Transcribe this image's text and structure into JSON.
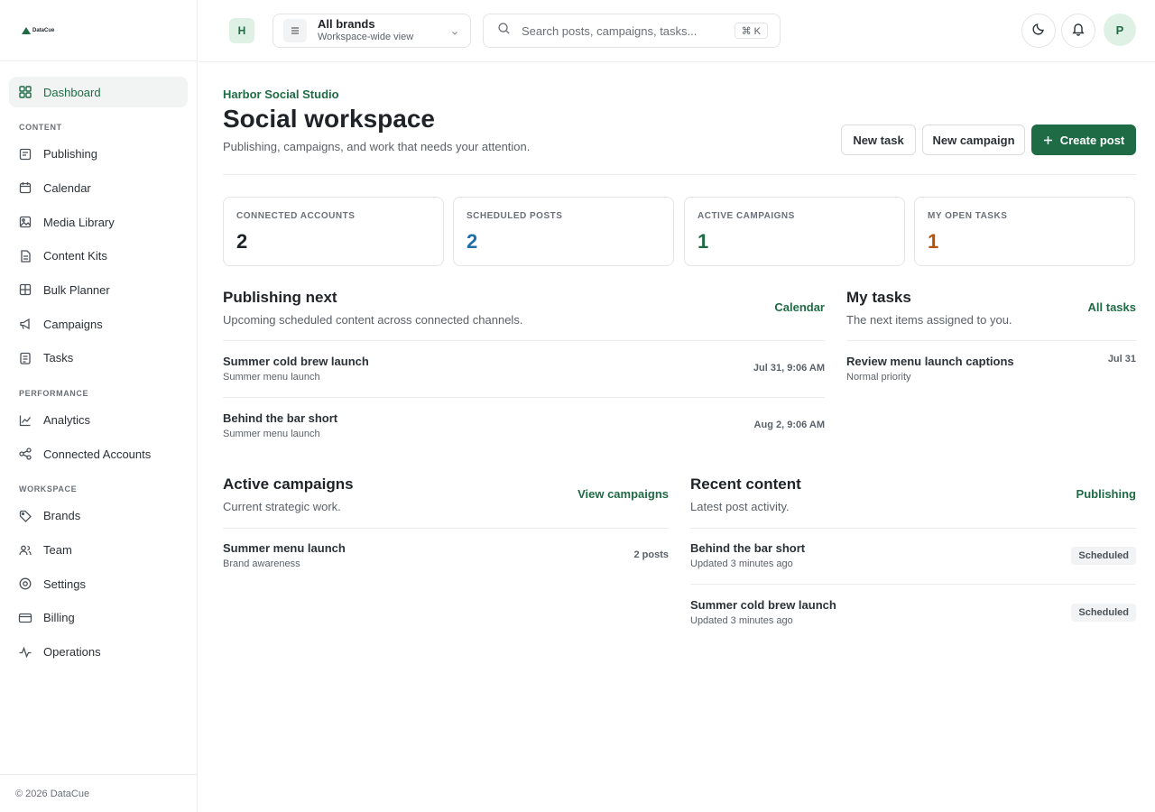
{
  "app": {
    "brand_name": "DataCue",
    "footer": "© 2026 DataCue"
  },
  "sidebar": {
    "top": [
      {
        "label": "Dashboard",
        "icon": "dashboard-icon",
        "active": true
      }
    ],
    "sections": [
      {
        "title": "CONTENT",
        "items": [
          {
            "label": "Publishing",
            "icon": "publishing-icon"
          },
          {
            "label": "Calendar",
            "icon": "calendar-icon"
          },
          {
            "label": "Media Library",
            "icon": "image-icon"
          },
          {
            "label": "Content Kits",
            "icon": "document-icon"
          },
          {
            "label": "Bulk Planner",
            "icon": "grid-icon"
          },
          {
            "label": "Campaigns",
            "icon": "megaphone-icon"
          },
          {
            "label": "Tasks",
            "icon": "checklist-icon"
          }
        ]
      },
      {
        "title": "PERFORMANCE",
        "items": [
          {
            "label": "Analytics",
            "icon": "chart-icon"
          },
          {
            "label": "Connected Accounts",
            "icon": "share-icon"
          }
        ]
      },
      {
        "title": "WORKSPACE",
        "items": [
          {
            "label": "Brands",
            "icon": "tag-icon"
          },
          {
            "label": "Team",
            "icon": "users-icon"
          },
          {
            "label": "Settings",
            "icon": "gear-icon"
          },
          {
            "label": "Billing",
            "icon": "card-icon"
          },
          {
            "label": "Operations",
            "icon": "pulse-icon"
          }
        ]
      }
    ]
  },
  "topbar": {
    "brand_initial": "H",
    "brand_selector": {
      "title": "All brands",
      "subtitle": "Workspace-wide view"
    },
    "search": {
      "placeholder": "Search posts, campaigns, tasks...",
      "shortcut": "⌘ K"
    },
    "avatar_initial": "P"
  },
  "header": {
    "eyebrow": "Harbor Social Studio",
    "title": "Social workspace",
    "subtitle": "Publishing, campaigns, and work that needs your attention.",
    "buttons": {
      "new_task": "New task",
      "new_campaign": "New campaign",
      "create_post": "Create post"
    }
  },
  "stats": [
    {
      "label": "CONNECTED ACCOUNTS",
      "value": "2",
      "color": "#1f2328"
    },
    {
      "label": "SCHEDULED POSTS",
      "value": "2",
      "color": "#1f6fa8"
    },
    {
      "label": "ACTIVE CAMPAIGNS",
      "value": "1",
      "color": "#1f6b45"
    },
    {
      "label": "MY OPEN TASKS",
      "value": "1",
      "color": "#b4530f"
    }
  ],
  "publishing_next": {
    "title": "Publishing next",
    "subtitle": "Upcoming scheduled content across connected channels.",
    "link": "Calendar",
    "rows": [
      {
        "title": "Summer cold brew launch",
        "sub": "Summer menu launch",
        "meta": "Jul 31, 9:06 AM"
      },
      {
        "title": "Behind the bar short",
        "sub": "Summer menu launch",
        "meta": "Aug 2, 9:06 AM"
      }
    ]
  },
  "my_tasks": {
    "title": "My tasks",
    "subtitle": "The next items assigned to you.",
    "link": "All tasks",
    "rows": [
      {
        "title": "Review menu launch captions",
        "sub": "Normal priority",
        "meta": "Jul 31"
      }
    ]
  },
  "active_campaigns": {
    "title": "Active campaigns",
    "subtitle": "Current strategic work.",
    "link": "View campaigns",
    "rows": [
      {
        "title": "Summer menu launch",
        "sub": "Brand awareness",
        "meta": "2 posts"
      }
    ]
  },
  "recent_content": {
    "title": "Recent content",
    "subtitle": "Latest post activity.",
    "link": "Publishing",
    "rows": [
      {
        "title": "Behind the bar short",
        "sub": "Updated 3 minutes ago",
        "status": "Scheduled"
      },
      {
        "title": "Summer cold brew launch",
        "sub": "Updated 3 minutes ago",
        "status": "Scheduled"
      }
    ]
  }
}
